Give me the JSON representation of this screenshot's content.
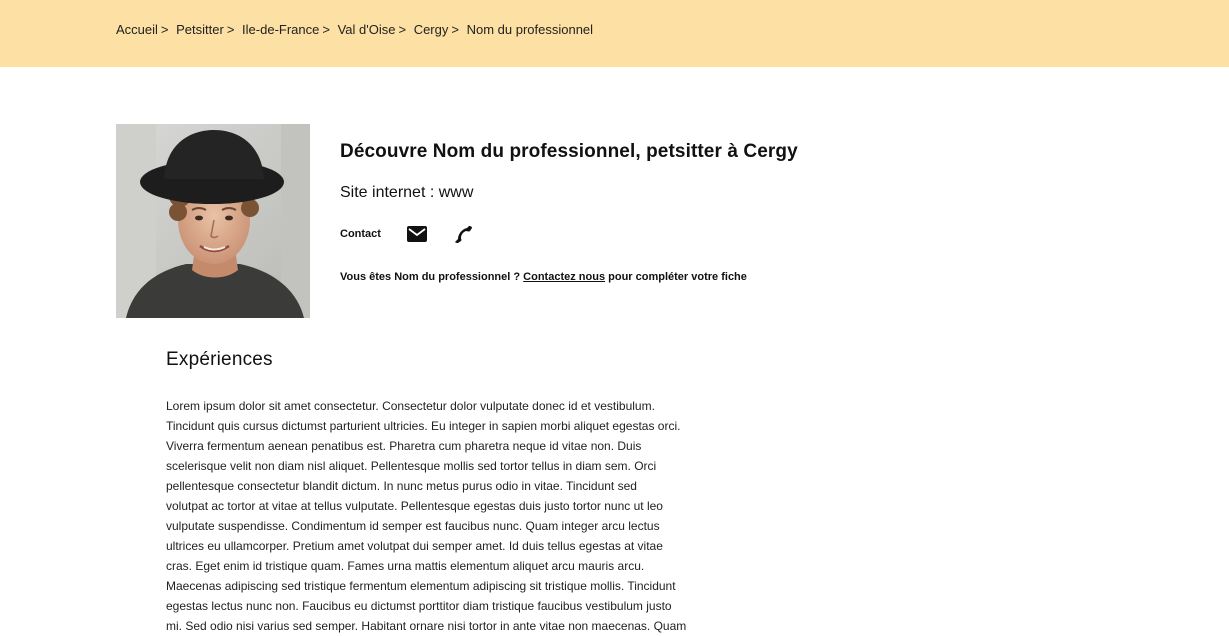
{
  "breadcrumb": {
    "items": [
      "Accueil",
      "Petsitter",
      "Ile-de-France",
      "Val d'Oise",
      "Cergy",
      "Nom du professionnel"
    ],
    "separator": ">"
  },
  "profile": {
    "title": "Découvre Nom du professionnel, petsitter à Cergy",
    "website": "Site internet : www",
    "contact_label": "Contact",
    "claim_prefix": "Vous êtes Nom du professionnel ?",
    "claim_link": "Contactez nous",
    "claim_suffix": "pour compléter votre fiche"
  },
  "icons": {
    "mail": "mail-icon",
    "phone": "phone-icon"
  },
  "experiences": {
    "title": "Expériences",
    "lines": [
      "Lorem ipsum dolor sit amet consectetur. Consectetur dolor vulputate donec id et vestibulum.",
      "Tincidunt quis cursus dictumst parturient ultricies. Eu integer in sapien morbi aliquet egestas orci.",
      "Viverra fermentum aenean penatibus est. Pharetra cum pharetra neque id vitae non. Duis",
      "scelerisque velit non diam nisl aliquet. Pellentesque mollis sed tortor tellus in diam sem. Orci",
      "pellentesque consectetur blandit dictum. In nunc metus purus odio in vitae. Tincidunt sed",
      "volutpat ac tortor at vitae at tellus vulputate. Pellentesque egestas duis justo tortor nunc ut leo",
      "vulputate suspendisse. Condimentum id semper est faucibus nunc. Quam integer arcu lectus",
      "ultrices eu ullamcorper. Pretium amet volutpat dui semper amet. Id duis tellus egestas at vitae",
      "cras. Eget enim id tristique quam. Fames urna mattis elementum aliquet arcu mauris arcu.",
      "Maecenas adipiscing sed tristique fermentum elementum adipiscing sit tristique mollis. Tincidunt",
      "egestas lectus nunc non. Faucibus eu dictumst porttitor diam tristique faucibus vestibulum justo",
      "mi. Sed odio nisi varius sed semper. Habitant ornare nisi tortor in ante vitae non maecenas. Quam"
    ]
  },
  "colors": {
    "topbar": "#fde0a3",
    "text": "#111111"
  }
}
